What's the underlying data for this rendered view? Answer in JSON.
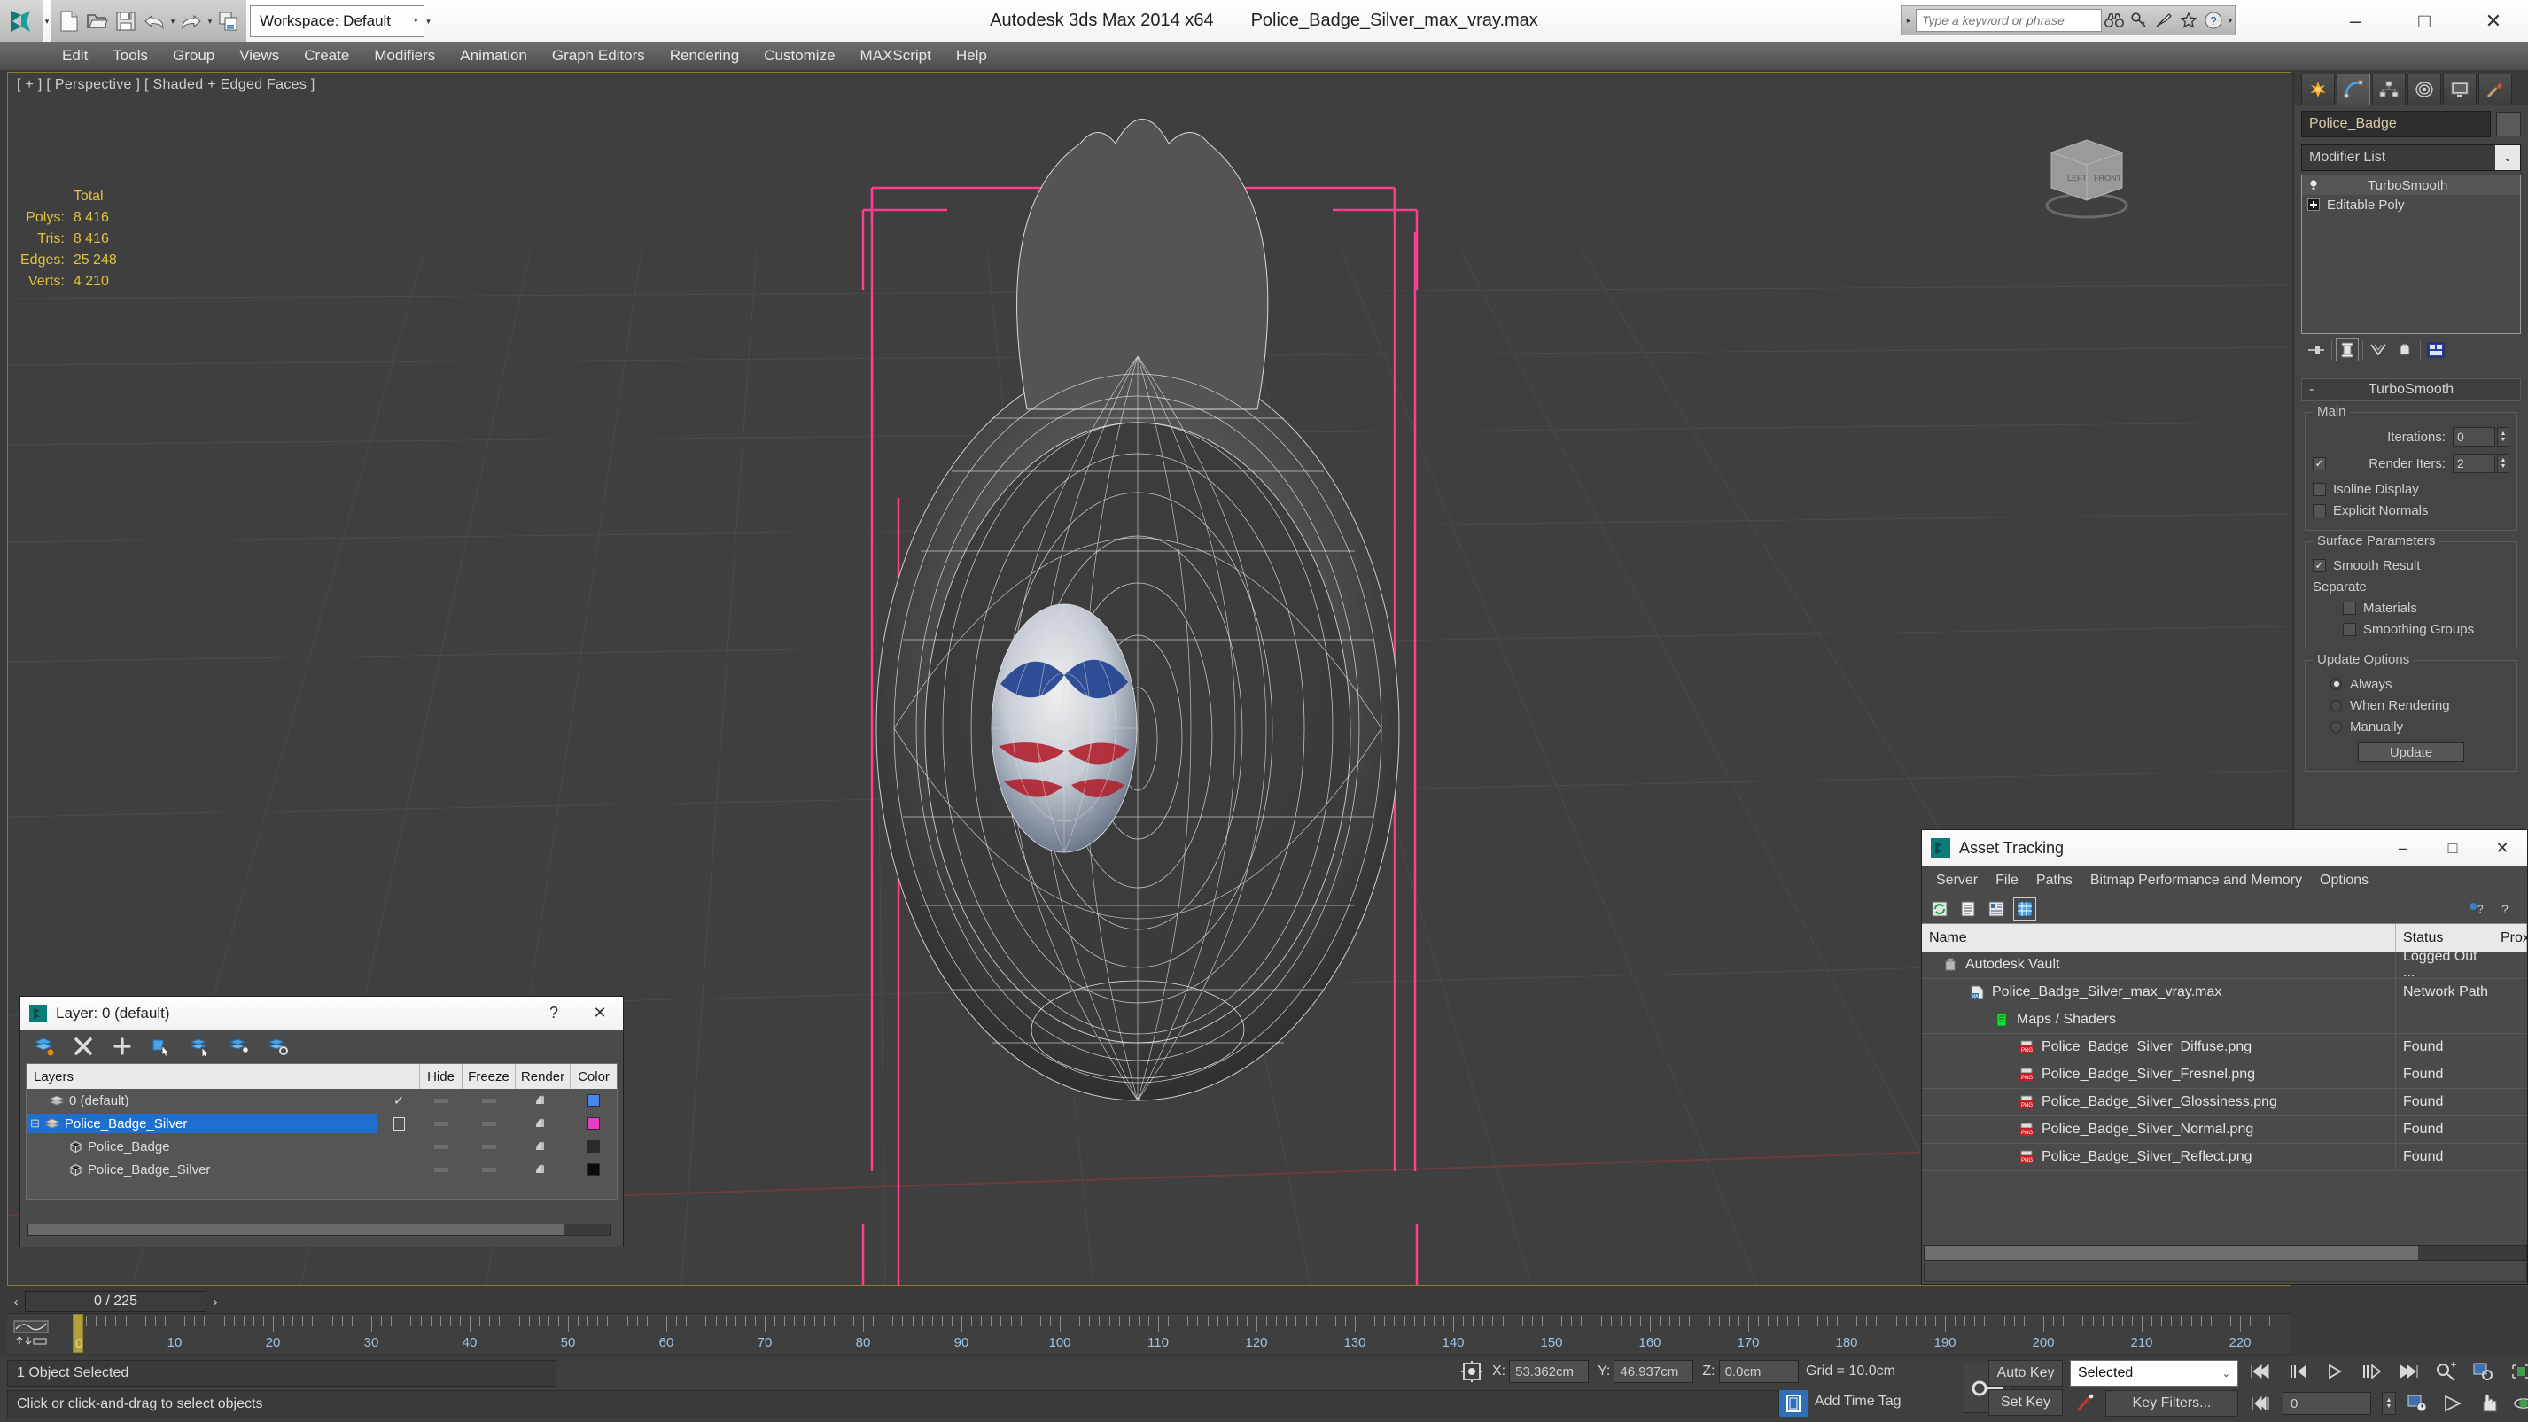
{
  "titlebar": {
    "app_title": "Autodesk 3ds Max  2014 x64",
    "file_title": "Police_Badge_Silver_max_vray.max",
    "minimize": "–",
    "maximize": "□",
    "close": "✕"
  },
  "quick_access": {
    "workspace_label": "Workspace: Default",
    "workspace_caret": "▾",
    "dropdown_caret": "▾",
    "icons": [
      "new-file-icon",
      "open-file-icon",
      "save-icon",
      "undo-icon",
      "redo-icon",
      "project-folder-icon"
    ]
  },
  "search": {
    "placeholder": "Type a keyword or phrase",
    "value": "",
    "arrow": "▸",
    "icons": [
      "binoculars-icon",
      "key-icon",
      "satellite-icon",
      "star-icon",
      "help-icon"
    ],
    "help_caret": "▾"
  },
  "menubar": {
    "items": [
      "Edit",
      "Tools",
      "Group",
      "Views",
      "Create",
      "Modifiers",
      "Animation",
      "Graph Editors",
      "Rendering",
      "Customize",
      "MAXScript",
      "Help"
    ]
  },
  "viewport": {
    "label": "[ + ] [ Perspective ] [ Shaded + Edged Faces ]",
    "stats_header": "Total",
    "stats": [
      {
        "label": "Polys:",
        "value": "8 416"
      },
      {
        "label": "Tris:",
        "value": "8 416"
      },
      {
        "label": "Edges:",
        "value": "25 248"
      },
      {
        "label": "Verts:",
        "value": "4 210"
      }
    ],
    "viewcube_faces": [
      "LEFT",
      "FRONT"
    ]
  },
  "command_panel": {
    "tabs": [
      "create-tab",
      "modify-tab",
      "hierarchy-tab",
      "motion-tab",
      "display-tab",
      "utilities-tab"
    ],
    "selected_tab_index": 1,
    "object_name": "Police_Badge",
    "modifier_list_label": "Modifier List",
    "modifier_list_caret": "⌄",
    "stack": [
      {
        "label": "TurboSmooth",
        "icon": "lightbulb-icon",
        "selected": true
      },
      {
        "label": "Editable Poly",
        "icon": "plus-box-icon",
        "selected": false
      }
    ],
    "stack_buttons": [
      "pin-stack-icon",
      "show-end-result-icon",
      "make-unique-icon",
      "remove-modifier-icon",
      "configure-sets-icon"
    ],
    "rollout": {
      "title": "TurboSmooth",
      "minus": "-",
      "main": {
        "title": "Main",
        "iterations_label": "Iterations:",
        "iterations_value": "0",
        "render_iters_label": "Render Iters:",
        "render_iters_value": "2",
        "render_iters_checked": true,
        "isoline_label": "Isoline Display",
        "isoline_checked": false,
        "explicit_label": "Explicit Normals",
        "explicit_checked": false
      },
      "surface": {
        "title": "Surface Parameters",
        "smooth_result_label": "Smooth Result",
        "smooth_result_checked": true,
        "separate_label": "Separate",
        "materials_label": "Materials",
        "materials_checked": false,
        "smoothing_groups_label": "Smoothing Groups",
        "smoothing_groups_checked": false
      },
      "update": {
        "title": "Update Options",
        "options": [
          "Always",
          "When Rendering",
          "Manually"
        ],
        "selected_index": 0,
        "button_label": "Update"
      }
    }
  },
  "asset_tracking": {
    "window_title": "Asset Tracking",
    "minimize": "–",
    "maximize": "□",
    "close": "✕",
    "menu": [
      "Server",
      "File",
      "Paths",
      "Bitmap Performance and Memory",
      "Options"
    ],
    "toolbar_icons": [
      "refresh-icon",
      "list-view-icon",
      "detail-view-icon",
      "grid-view-icon",
      "help-new-icon",
      "help-icon"
    ],
    "columns": [
      "Name",
      "Status",
      "Prox"
    ],
    "rows": [
      {
        "name": "Autodesk Vault",
        "status": "Logged Out ...",
        "indent": 1,
        "icon": "vault-icon"
      },
      {
        "name": "Police_Badge_Silver_max_vray.max",
        "status": "Network Path",
        "indent": 2,
        "icon": "max-file-icon"
      },
      {
        "name": "Maps / Shaders",
        "status": "",
        "indent": 3,
        "icon": "maps-shaders-icon"
      },
      {
        "name": "Police_Badge_Silver_Diffuse.png",
        "status": "Found",
        "indent": 4,
        "icon": "png-icon"
      },
      {
        "name": "Police_Badge_Silver_Fresnel.png",
        "status": "Found",
        "indent": 4,
        "icon": "png-icon"
      },
      {
        "name": "Police_Badge_Silver_Glossiness.png",
        "status": "Found",
        "indent": 4,
        "icon": "png-icon"
      },
      {
        "name": "Police_Badge_Silver_Normal.png",
        "status": "Found",
        "indent": 4,
        "icon": "png-icon"
      },
      {
        "name": "Police_Badge_Silver_Reflect.png",
        "status": "Found",
        "indent": 4,
        "icon": "png-icon"
      }
    ]
  },
  "layer_dialog": {
    "window_title": "Layer: 0 (default)",
    "help": "?",
    "close": "✕",
    "toolbar_icons": [
      "create-new-layer-icon",
      "delete-layer-icon",
      "add-layer-icon",
      "select-objects-in-layer-icon",
      "select-highlighted-objects-icon",
      "highlight-selected-objects-icon",
      "layer-properties-icon"
    ],
    "columns": [
      "Layers",
      "Hide",
      "Freeze",
      "Render",
      "Color"
    ],
    "rows": [
      {
        "name": "0 (default)",
        "type": "layer",
        "indent": 1,
        "current": true,
        "check": "✓",
        "color": "#4a86e8",
        "expander": ""
      },
      {
        "name": "Police_Badge_Silver",
        "type": "layer",
        "indent": 0,
        "current": false,
        "check": "",
        "color": "#e83fc0",
        "expander": "⊟",
        "selected": true
      },
      {
        "name": "Police_Badge",
        "type": "object",
        "indent": 2,
        "current": false,
        "check": "",
        "color": "#2b2b2b",
        "expander": ""
      },
      {
        "name": "Police_Badge_Silver",
        "type": "object",
        "indent": 2,
        "current": false,
        "check": "",
        "color": "#0a0a0a",
        "expander": ""
      }
    ]
  },
  "timeline": {
    "frame_display": "0 / 225",
    "prev_arrow": "‹",
    "next_arrow": "›",
    "playhead_label": "0",
    "tick_labels": [
      "10",
      "20",
      "30",
      "40",
      "50",
      "60",
      "70",
      "80",
      "90",
      "100",
      "110",
      "120",
      "130",
      "140",
      "150",
      "160",
      "170",
      "180",
      "190",
      "200",
      "210",
      "220"
    ]
  },
  "statusbar": {
    "selection_text": "1 Object Selected",
    "prompt_text": "Click or click-and-drag to select objects",
    "coords": [
      {
        "key": "X:",
        "value": "53.362cm"
      },
      {
        "key": "Y:",
        "value": "46.937cm"
      },
      {
        "key": "Z:",
        "value": "0.0cm"
      }
    ],
    "grid_text": "Grid = 10.0cm",
    "add_time_tag": "Add Time Tag",
    "auto_key": "Auto Key",
    "set_key": "Set Key",
    "key_mode": "Selected",
    "key_mode_caret": "⌄",
    "key_filters": "Key Filters...",
    "frame_value": "0",
    "playback_icons": [
      "go-to-start-icon",
      "previous-frame-icon",
      "play-animation-icon",
      "next-frame-icon",
      "go-to-end-icon",
      "zoom-time-icon",
      "zoom-region-icon",
      "zoom-extents-icon",
      "zoom-extents-all-icon"
    ],
    "playback_icons2": [
      "key-mode-toggle-icon",
      "time-configuration-icon",
      "field-of-view-icon",
      "pan-view-icon",
      "orbit-icon",
      "maximize-viewport-icon"
    ]
  },
  "colors": {
    "accent_blue": "#1f6fd0",
    "stat_yellow": "#e0c23a",
    "viewport_bg": "#3f3f3f",
    "panel_bg": "#454545",
    "layer_pink": "#e83fc0",
    "layer_blue": "#4a86e8"
  }
}
